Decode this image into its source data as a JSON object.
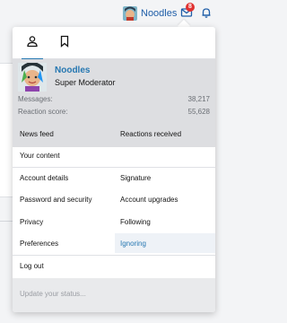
{
  "nav": {
    "username": "Noodles",
    "inbox_badge": "8"
  },
  "menu": {
    "tabs": [
      {
        "icon": "user-icon",
        "active": true
      },
      {
        "icon": "bookmark-icon",
        "active": false
      }
    ],
    "profile": {
      "username": "Noodles",
      "title": "Super Moderator",
      "messages_label": "Messages:",
      "messages_value": "38,217",
      "reaction_label": "Reaction score:",
      "reaction_value": "55,628"
    },
    "links": {
      "news_feed": "News feed",
      "reactions_received": "Reactions received",
      "your_content": "Your content",
      "account_details": "Account details",
      "signature": "Signature",
      "password_security": "Password and security",
      "account_upgrades": "Account upgrades",
      "privacy": "Privacy",
      "following": "Following",
      "preferences": "Preferences",
      "ignoring": "Ignoring",
      "log_out": "Log out"
    },
    "status_placeholder": "Update your status..."
  },
  "colors": {
    "accent": "#2577b1",
    "profile_bg": "#dddee1",
    "badge": "#e03131"
  }
}
